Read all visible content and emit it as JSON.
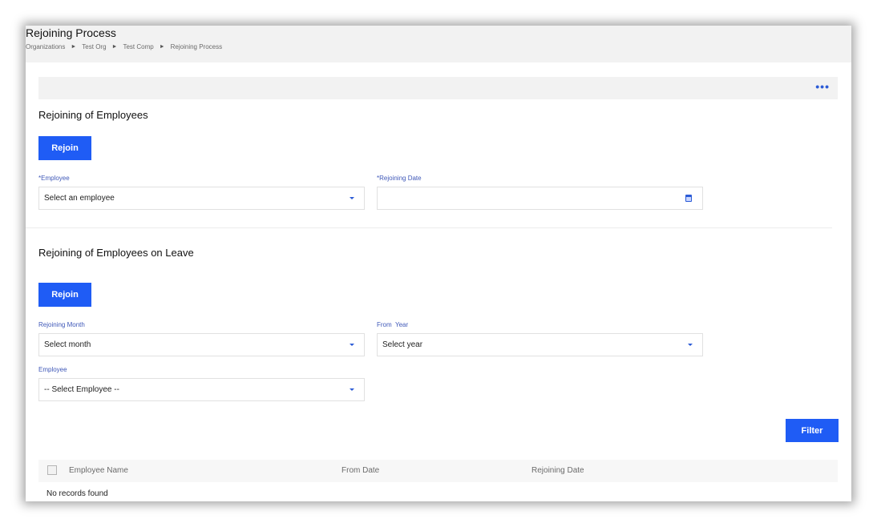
{
  "page": {
    "title": "Rejoining Process",
    "breadcrumb": [
      "Organizations",
      "Test Org",
      "Test Comp",
      "Rejoining Process"
    ]
  },
  "toolbar": {
    "more_label": "•••"
  },
  "section1": {
    "title": "Rejoining of Employees",
    "button_label": "Rejoin",
    "employee_label": "*Employee",
    "employee_value": "Select an employee",
    "rejoining_date_label": "*Rejoining Date",
    "rejoining_date_value": ""
  },
  "section2": {
    "title": "Rejoining of Employees on Leave",
    "button_label": "Rejoin",
    "month_label": "Rejoining Month",
    "month_value": "Select month",
    "year_label": "From  Year",
    "year_value": "Select year",
    "employee_label": "Employee",
    "employee_value": "-- Select Employee --",
    "filter_label": "Filter"
  },
  "table": {
    "columns": [
      "Employee Name",
      "From Date",
      "Rejoining Date"
    ],
    "empty_text": "No records found"
  },
  "colors": {
    "accent": "#1f5cf5",
    "label": "#3f58b8",
    "header_bg": "#f2f2f2"
  }
}
